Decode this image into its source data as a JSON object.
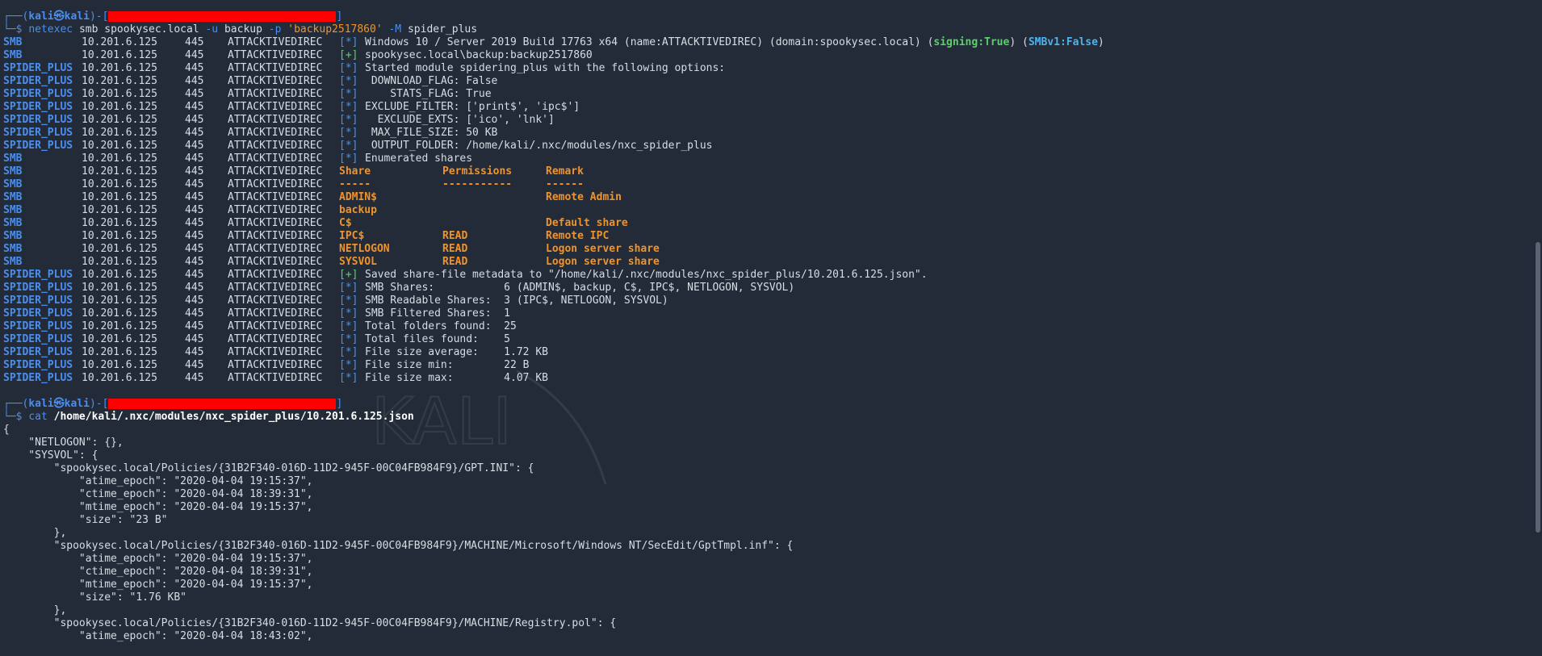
{
  "colors": {
    "background": "#222b37",
    "prompt": "#4a8ff0",
    "info": "#4a8ff0",
    "success": "#5bd06a",
    "table_header": "#f0932b"
  },
  "prompt1": {
    "user": "kali",
    "host": "kali",
    "at": "㉿",
    "cmd": "netexec",
    "args": "smb spookysec.local",
    "opt_u": "-u",
    "user_arg": "backup",
    "opt_p": "-p",
    "pass_arg": "'backup2517860'",
    "opt_m": "-M",
    "module": "spider_plus"
  },
  "output": [
    {
      "proto": "SMB",
      "ip": "10.201.6.125",
      "port": "445",
      "host": "ATTACKTIVEDIREC",
      "tag": "[*]",
      "text": "Windows 10 / Server 2019 Build 17763 x64 (name:ATTACKTIVEDIREC) (domain:spookysec.local) (",
      "signing": "signing:True",
      "mid": ") (",
      "smbv1": "SMBv1:False",
      "end": ")"
    },
    {
      "proto": "SMB",
      "ip": "10.201.6.125",
      "port": "445",
      "host": "ATTACKTIVEDIREC",
      "tag": "[+]",
      "text": "spookysec.local\\backup:backup2517860"
    },
    {
      "proto": "SPIDER_PLUS",
      "ip": "10.201.6.125",
      "port": "445",
      "host": "ATTACKTIVEDIREC",
      "tag": "[*]",
      "text": "Started module spidering_plus with the following options:"
    },
    {
      "proto": "SPIDER_PLUS",
      "ip": "10.201.6.125",
      "port": "445",
      "host": "ATTACKTIVEDIREC",
      "tag": "[*]",
      "text": " DOWNLOAD_FLAG: False"
    },
    {
      "proto": "SPIDER_PLUS",
      "ip": "10.201.6.125",
      "port": "445",
      "host": "ATTACKTIVEDIREC",
      "tag": "[*]",
      "text": "    STATS_FLAG: True"
    },
    {
      "proto": "SPIDER_PLUS",
      "ip": "10.201.6.125",
      "port": "445",
      "host": "ATTACKTIVEDIREC",
      "tag": "[*]",
      "text": "EXCLUDE_FILTER: ['print$', 'ipc$']"
    },
    {
      "proto": "SPIDER_PLUS",
      "ip": "10.201.6.125",
      "port": "445",
      "host": "ATTACKTIVEDIREC",
      "tag": "[*]",
      "text": "  EXCLUDE_EXTS: ['ico', 'lnk']"
    },
    {
      "proto": "SPIDER_PLUS",
      "ip": "10.201.6.125",
      "port": "445",
      "host": "ATTACKTIVEDIREC",
      "tag": "[*]",
      "text": " MAX_FILE_SIZE: 50 KB"
    },
    {
      "proto": "SPIDER_PLUS",
      "ip": "10.201.6.125",
      "port": "445",
      "host": "ATTACKTIVEDIREC",
      "tag": "[*]",
      "text": " OUTPUT_FOLDER: /home/kali/.nxc/modules/nxc_spider_plus"
    },
    {
      "proto": "SMB",
      "ip": "10.201.6.125",
      "port": "445",
      "host": "ATTACKTIVEDIREC",
      "tag": "[*]",
      "text": "Enumerated shares"
    }
  ],
  "share_table": {
    "headers": [
      "Share",
      "Permissions",
      "Remark"
    ],
    "underlines": [
      "-----",
      "-----------",
      "------"
    ],
    "rows": [
      {
        "share": "ADMIN$",
        "perm": "",
        "remark": "Remote Admin"
      },
      {
        "share": "backup",
        "perm": "",
        "remark": ""
      },
      {
        "share": "C$",
        "perm": "",
        "remark": "Default share"
      },
      {
        "share": "IPC$",
        "perm": "READ",
        "remark": "Remote IPC"
      },
      {
        "share": "NETLOGON",
        "perm": "READ",
        "remark": "Logon server share"
      },
      {
        "share": "SYSVOL",
        "perm": "READ",
        "remark": "Logon server share"
      }
    ]
  },
  "summary": [
    {
      "tag": "[+]",
      "text": "Saved share-file metadata to \"/home/kali/.nxc/modules/nxc_spider_plus/10.201.6.125.json\"."
    },
    {
      "tag": "[*]",
      "text": "SMB Shares:           6 (ADMIN$, backup, C$, IPC$, NETLOGON, SYSVOL)"
    },
    {
      "tag": "[*]",
      "text": "SMB Readable Shares:  3 (IPC$, NETLOGON, SYSVOL)"
    },
    {
      "tag": "[*]",
      "text": "SMB Filtered Shares:  1"
    },
    {
      "tag": "[*]",
      "text": "Total folders found:  25"
    },
    {
      "tag": "[*]",
      "text": "Total files found:    5"
    },
    {
      "tag": "[*]",
      "text": "File size average:    1.72 KB"
    },
    {
      "tag": "[*]",
      "text": "File size min:        22 B"
    },
    {
      "tag": "[*]",
      "text": "File size max:        4.07 KB"
    }
  ],
  "summary_proto": "SPIDER_PLUS",
  "row_ip": "10.201.6.125",
  "row_port": "445",
  "row_host": "ATTACKTIVEDIREC",
  "table_proto": "SMB",
  "prompt2": {
    "user": "kali",
    "host": "kali",
    "at": "㉿",
    "cmd": "cat",
    "path": "/home/kali/.nxc/modules/nxc_spider_plus/10.201.6.125.json"
  },
  "json_lines": [
    "{",
    "    \"NETLOGON\": {},",
    "    \"SYSVOL\": {",
    "        \"spookysec.local/Policies/{31B2F340-016D-11D2-945F-00C04FB984F9}/GPT.INI\": {",
    "            \"atime_epoch\": \"2020-04-04 19:15:37\",",
    "            \"ctime_epoch\": \"2020-04-04 18:39:31\",",
    "            \"mtime_epoch\": \"2020-04-04 19:15:37\",",
    "            \"size\": \"23 B\"",
    "        },",
    "        \"spookysec.local/Policies/{31B2F340-016D-11D2-945F-00C04FB984F9}/MACHINE/Microsoft/Windows NT/SecEdit/GptTmpl.inf\": {",
    "            \"atime_epoch\": \"2020-04-04 19:15:37\",",
    "            \"ctime_epoch\": \"2020-04-04 18:39:31\",",
    "            \"mtime_epoch\": \"2020-04-04 19:15:37\",",
    "            \"size\": \"1.76 KB\"",
    "        },",
    "        \"spookysec.local/Policies/{31B2F340-016D-11D2-945F-00C04FB984F9}/MACHINE/Registry.pol\": {",
    "            \"atime_epoch\": \"2020-04-04 18:43:02\","
  ]
}
